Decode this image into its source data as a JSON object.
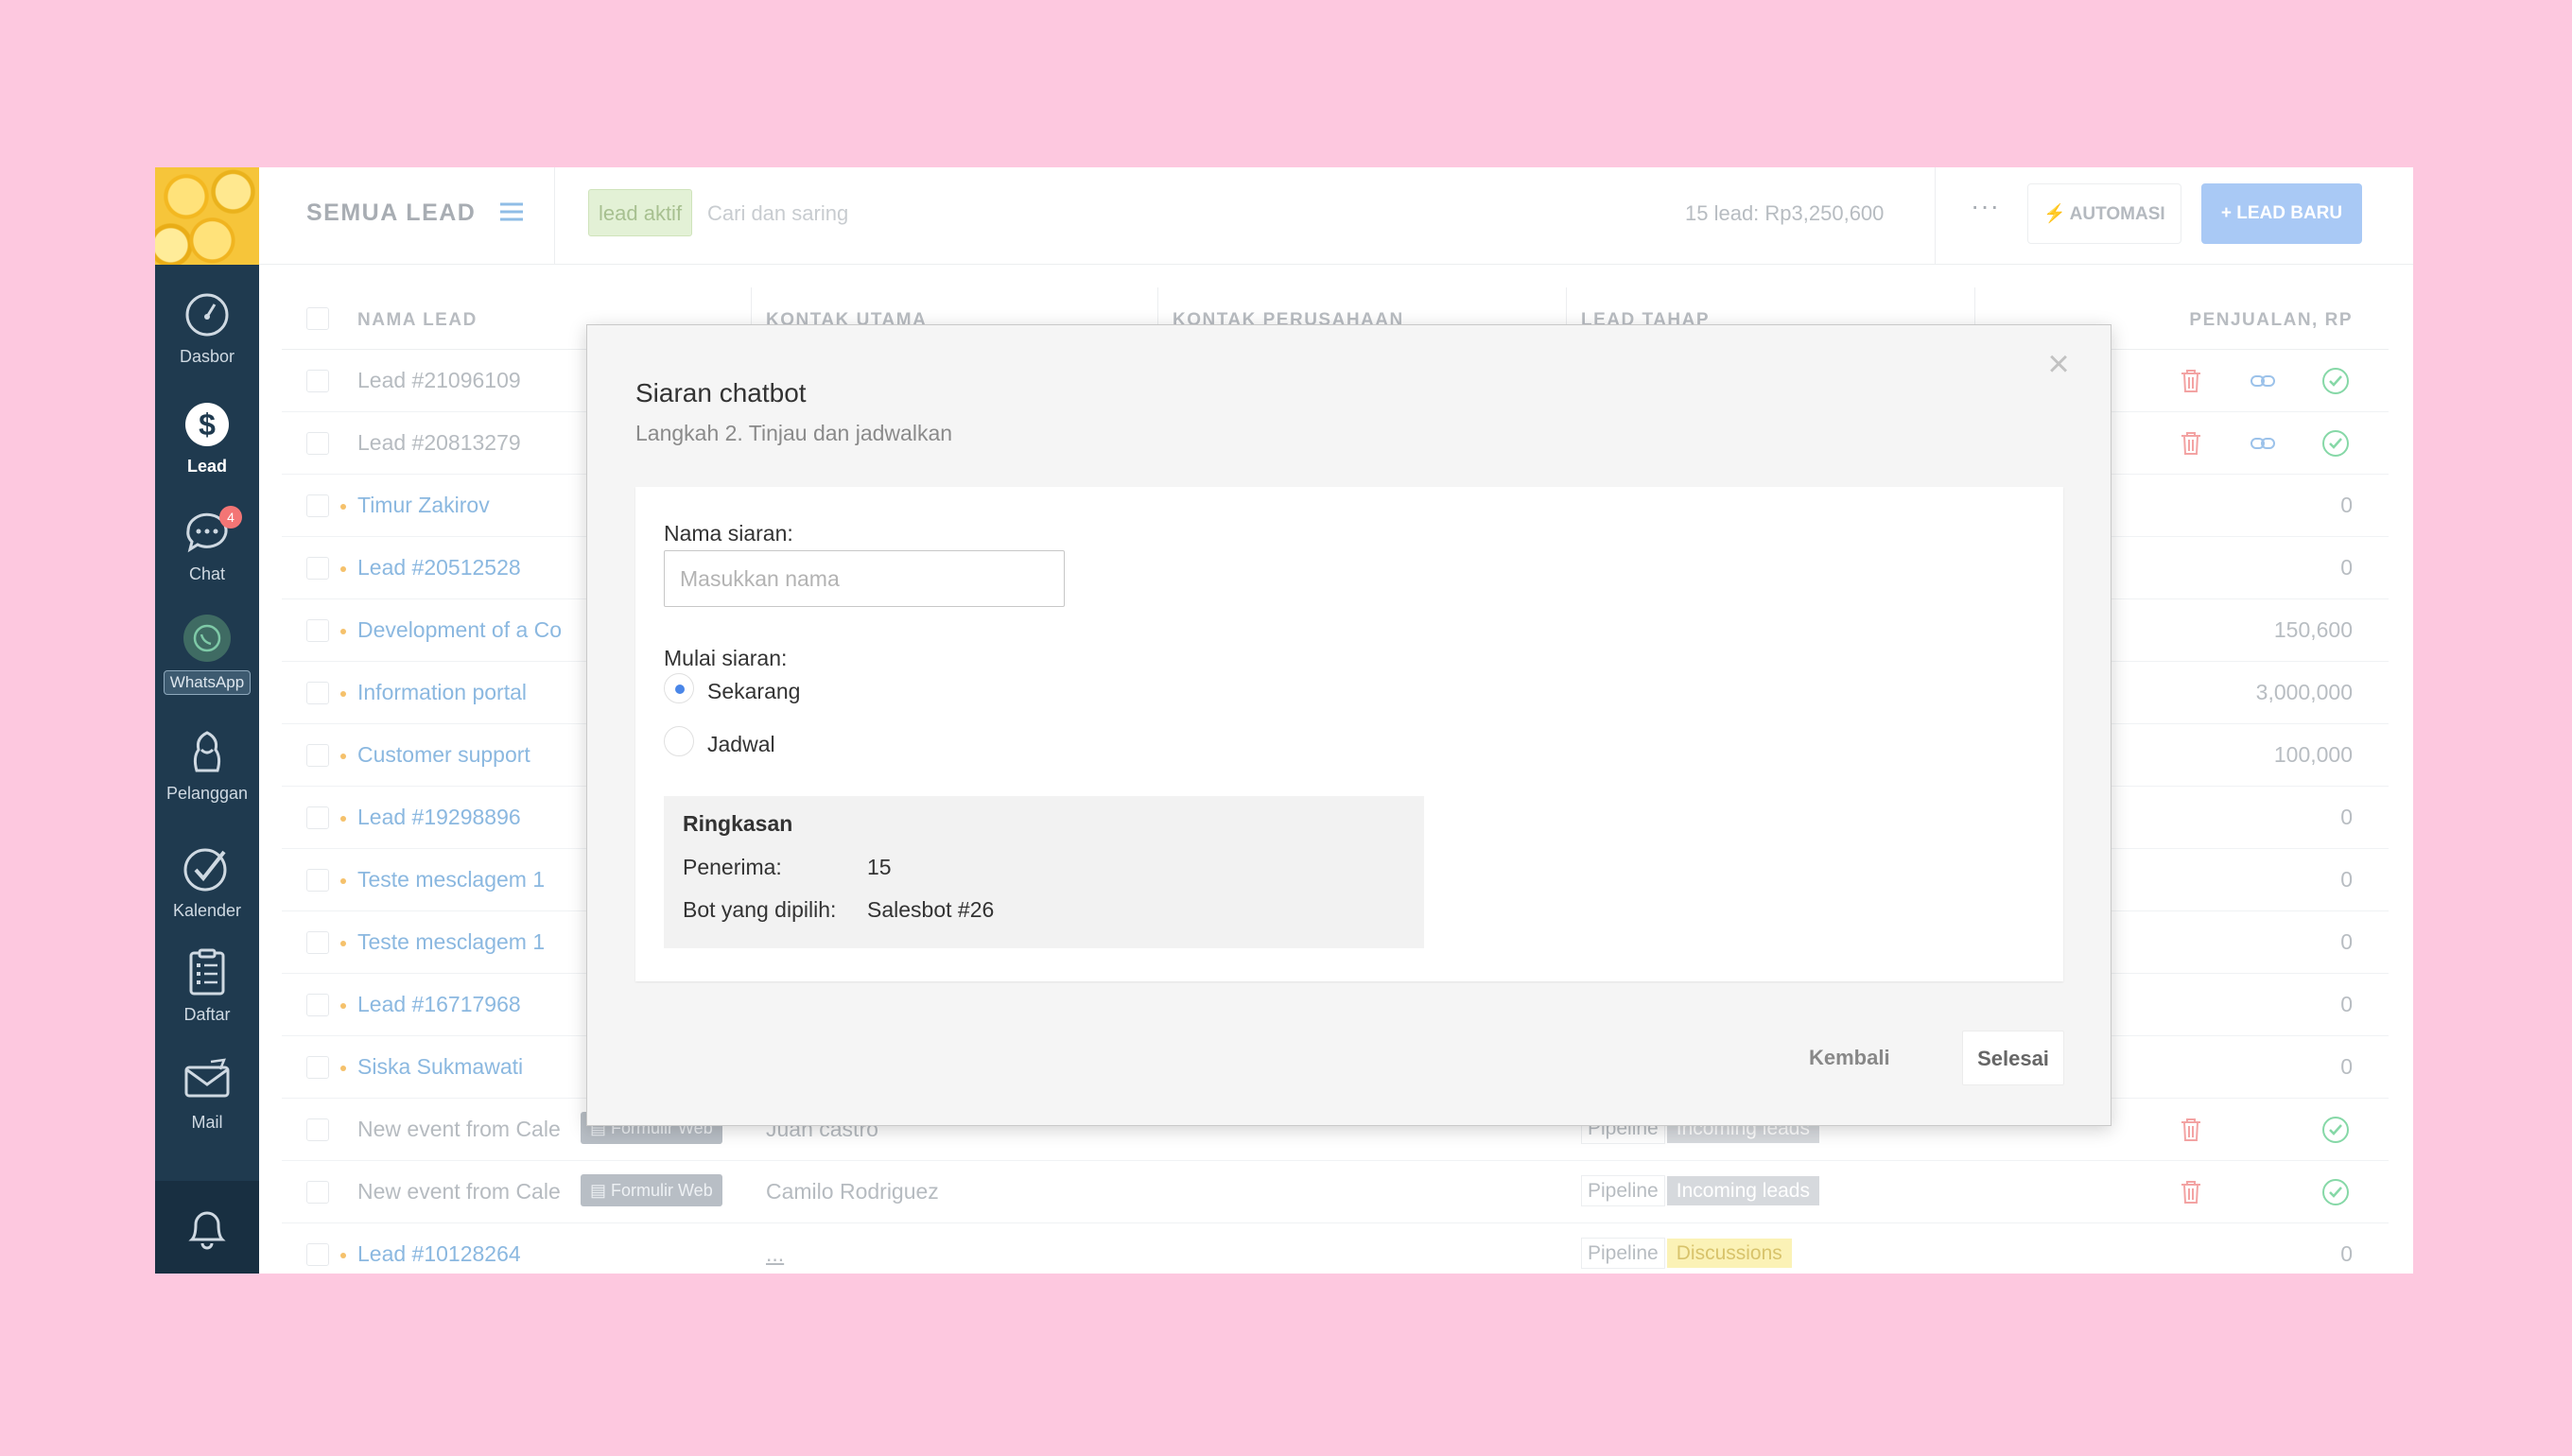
{
  "topbar": {
    "title": "SEMUA LEAD",
    "filter_tag": "lead aktif",
    "search_placeholder": "Cari dan saring",
    "lead_summary": "15 lead: Rp3,250,600",
    "more": "···",
    "automasi_label": "AUTOMASI",
    "lead_baru_label": "+ LEAD BARU"
  },
  "sidebar": {
    "items": [
      {
        "label": "Dasbor",
        "icon": "dashboard-icon"
      },
      {
        "label": "Lead",
        "icon": "lead-icon"
      },
      {
        "label": "Chat",
        "icon": "chat-icon",
        "badge": "4"
      },
      {
        "label": "WhatsApp",
        "icon": "whatsapp-icon"
      },
      {
        "label": "Pelanggan",
        "icon": "customers-icon"
      },
      {
        "label": "Kalender",
        "icon": "calendar-check-icon"
      },
      {
        "label": "Daftar",
        "icon": "list-icon"
      },
      {
        "label": "Mail",
        "icon": "mail-icon"
      }
    ]
  },
  "table": {
    "headers": {
      "name": "NAMA LEAD",
      "main_contact": "KONTAK UTAMA",
      "company_contact": "KONTAK PERUSAHAAN",
      "stage": "LEAD TAHAP",
      "sales": "PENJUALAN, RP"
    },
    "rows": [
      {
        "name": "Lead #21096109",
        "amount": ""
      },
      {
        "name": "Lead #20813279",
        "amount": ""
      },
      {
        "name": "Timur Zakirov",
        "amount": "0"
      },
      {
        "name": "Lead #20512528",
        "amount": "0"
      },
      {
        "name": "Development of a Co",
        "amount": "150,600"
      },
      {
        "name": "Information portal",
        "amount": "3,000,000"
      },
      {
        "name": "Customer support",
        "amount": "100,000"
      },
      {
        "name": "Lead #19298896",
        "amount": "0"
      },
      {
        "name": "Teste mesclagem 1",
        "amount": "0"
      },
      {
        "name": "Teste mesclagem 1",
        "amount": "0"
      },
      {
        "name": "Lead #16717968",
        "amount": "0"
      },
      {
        "name": "Siska Sukmawati",
        "amount": "0"
      },
      {
        "name": "New event from Cale",
        "tag": "Formulir Web",
        "contact": "Juan castro",
        "pipeline": "Pipeline",
        "stage": "Incoming leads",
        "amount": ""
      },
      {
        "name": "New event from Cale",
        "tag": "Formulir Web",
        "contact": "Camilo Rodriguez",
        "pipeline": "Pipeline",
        "stage": "Incoming leads",
        "amount": ""
      },
      {
        "name": "Lead #10128264",
        "contact": "...",
        "pipeline": "Pipeline",
        "stage": "Discussions",
        "amount": "0"
      }
    ]
  },
  "modal": {
    "title": "Siaran chatbot",
    "subtitle": "Langkah 2. Tinjau dan jadwalkan",
    "name_label": "Nama siaran:",
    "name_placeholder": "Masukkan nama",
    "name_value": "",
    "start_label": "Mulai siaran:",
    "options": [
      "Sekarang",
      "Jadwal"
    ],
    "selected_option": "Sekarang",
    "summary": {
      "title": "Ringkasan",
      "recipients_label": "Penerima:",
      "recipients_value": "15",
      "bot_label": "Bot yang dipilih:",
      "bot_value": "Salesbot #26"
    },
    "back_label": "Kembali",
    "done_label": "Selesai",
    "close_symbol": "×"
  },
  "colors": {
    "page_background": "#fdc8df",
    "sidebar": "#1f3a4f",
    "link": "#8bb8e0",
    "primary_button": "#a9c9f5",
    "radio_accent": "#4a86e8",
    "delete_icon": "#f3a3a3",
    "confirm_icon": "#86d8a7"
  }
}
